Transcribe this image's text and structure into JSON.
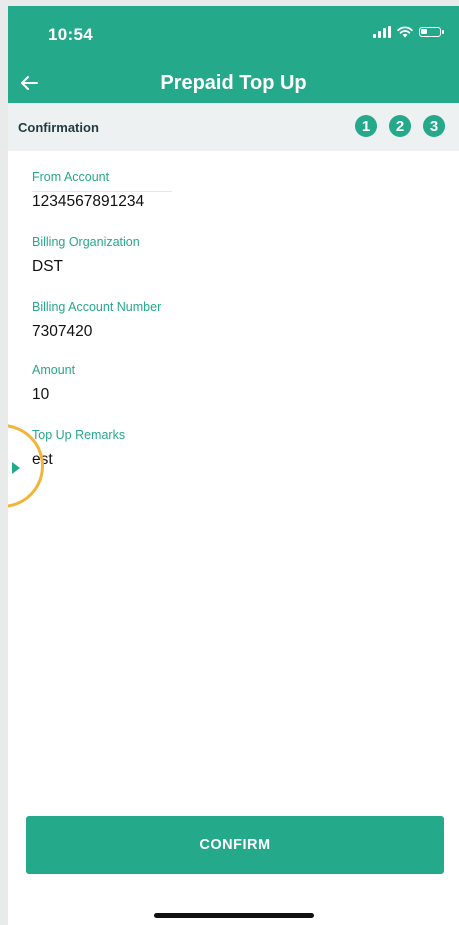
{
  "status_bar": {
    "time": "10:54"
  },
  "header": {
    "title": "Prepaid Top Up",
    "back_icon": "arrow-left-icon"
  },
  "subheader": {
    "label": "Confirmation",
    "steps": [
      "1",
      "2",
      "3"
    ]
  },
  "fields": [
    {
      "label": "From Account",
      "value": "1234567891234"
    },
    {
      "label": "Billing Organization",
      "value": "DST"
    },
    {
      "label": "Billing Account Number",
      "value": "7307420"
    },
    {
      "label": "Amount",
      "value": "10"
    },
    {
      "label": "Top Up Remarks",
      "value": "est"
    }
  ],
  "confirm_button": {
    "label": "CONFIRM"
  },
  "colors": {
    "primary": "#25a98b",
    "highlight": "#f2b43b"
  }
}
